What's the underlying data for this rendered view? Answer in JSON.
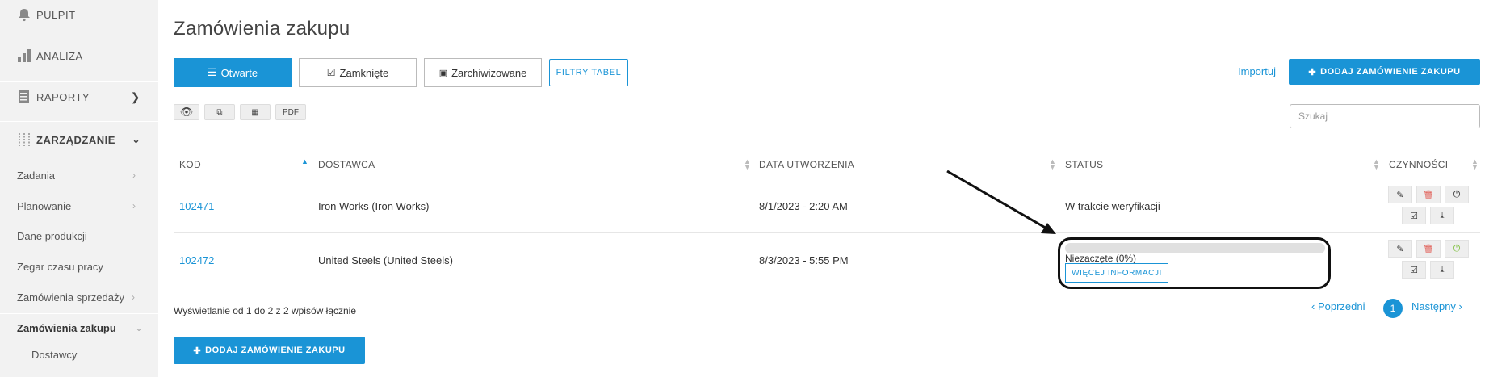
{
  "sidebar": {
    "top_items": [
      {
        "label": "PULPIT",
        "icon": "bell-icon"
      },
      {
        "label": "ANALIZA",
        "icon": "bar-chart-icon"
      },
      {
        "label": "RAPORTY",
        "icon": "document-icon"
      },
      {
        "label": "ZARZĄDZANIE",
        "icon": "sliders-icon"
      }
    ],
    "sub_items": [
      {
        "label": "Zadania"
      },
      {
        "label": "Planowanie"
      },
      {
        "label": "Dane produkcji"
      },
      {
        "label": "Zegar czasu pracy"
      },
      {
        "label": "Zamówienia sprzedaży"
      },
      {
        "label": "Zamówienia zakupu"
      }
    ],
    "subsub_items": [
      {
        "label": "Dostawcy"
      }
    ]
  },
  "main": {
    "title": "Zamówienia zakupu",
    "tabs": [
      {
        "label": "Otwarte",
        "icon": "list-icon"
      },
      {
        "label": "Zamknięte",
        "icon": "check-square-icon"
      },
      {
        "label": "Zarchiwizowane",
        "icon": "inbox-icon"
      }
    ],
    "filter_label": "FILTRY TABEL",
    "import_label": "Importuj",
    "add_label": "DODAJ ZAMÓWIENIE ZAKUPU",
    "tools": [
      {
        "label": "",
        "icon": "eye-icon"
      },
      {
        "label": "",
        "icon": "copy-icon"
      },
      {
        "label": "",
        "icon": "table-icon"
      },
      {
        "label": "PDF"
      }
    ],
    "search": {
      "placeholder": "Szukaj",
      "value": ""
    }
  },
  "table": {
    "columns": [
      "KOD",
      "DOSTAWCA",
      "DATA UTWORZENIA",
      "STATUS",
      "CZYNNOŚCI"
    ],
    "rows": [
      {
        "code": "102471",
        "supplier": "Iron Works (Iron Works)",
        "date": "8/1/2023 - 2:20 AM",
        "status": "W trakcie weryfikacji"
      },
      {
        "code": "102472",
        "supplier": "United Steels (United Steels)",
        "date": "8/3/2023 - 5:55 PM",
        "status": "Niezaczęte (0%)",
        "progress": 0,
        "more_label": "WIĘCEJ INFORMACJI"
      }
    ]
  },
  "footer": {
    "summary": "Wyświetlanie od 1 do 2 z 2 wpisów łącznie",
    "prev_label": "‹ Poprzedni",
    "next_label": "Następny ›",
    "current_page": "1"
  },
  "colors": {
    "accent": "#1a94d6",
    "delete": "#e0574f",
    "power_on": "#7cbf3a"
  }
}
